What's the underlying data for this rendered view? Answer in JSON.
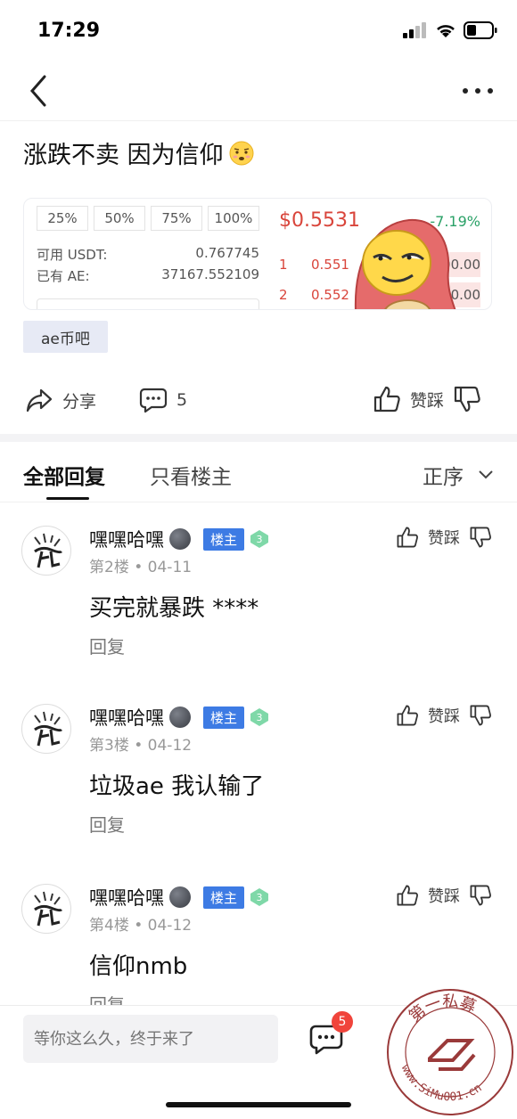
{
  "status_bar": {
    "time": "17:29"
  },
  "post": {
    "title": "涨跌不卖 因为信仰",
    "tag": "ae币吧"
  },
  "embed": {
    "pct_buttons": [
      "25%",
      "50%",
      "75%",
      "100%"
    ],
    "available_label": "可用 USDT:",
    "available_value": "0.767745",
    "held_label": "已有 AE:",
    "held_value": "37167.552109",
    "price": "$0.5531",
    "change": "-7.19%",
    "orderbook": [
      {
        "idx": "1",
        "price": "0.551",
        "vol": "3600.00"
      },
      {
        "idx": "2",
        "price": "0.552",
        "vol": "8000.00"
      }
    ]
  },
  "actions": {
    "share": "分享",
    "comments_count": "5",
    "vote": "赞踩"
  },
  "tabs": {
    "all": "全部回复",
    "host_only": "只看楼主",
    "sort": "正序"
  },
  "replies": [
    {
      "name": "嘿嘿哈嘿",
      "badge": "楼主",
      "level": "3",
      "floor": "第2楼",
      "date": "04-11",
      "content": "买完就暴跌 ****",
      "reply": "回复",
      "vote": "赞踩"
    },
    {
      "name": "嘿嘿哈嘿",
      "badge": "楼主",
      "level": "3",
      "floor": "第3楼",
      "date": "04-12",
      "content": "垃圾ae 我认输了",
      "reply": "回复",
      "vote": "赞踩"
    },
    {
      "name": "嘿嘿哈嘿",
      "badge": "楼主",
      "level": "3",
      "floor": "第4楼",
      "date": "04-12",
      "content": "信仰nmb",
      "reply": "回复",
      "vote": "赞踩"
    }
  ],
  "bottom_bar": {
    "input_placeholder": "等你这么久，终于来了",
    "badge_count": "5"
  },
  "watermark": {
    "text": "第一私募",
    "url": "www.SiMu001.cn"
  },
  "colors": {
    "price_red": "#d9453b",
    "change_green": "#2aa167",
    "host_badge_blue": "#3d7be4",
    "tag_bg": "#e7eaf5",
    "notif_red": "#f0443b"
  }
}
